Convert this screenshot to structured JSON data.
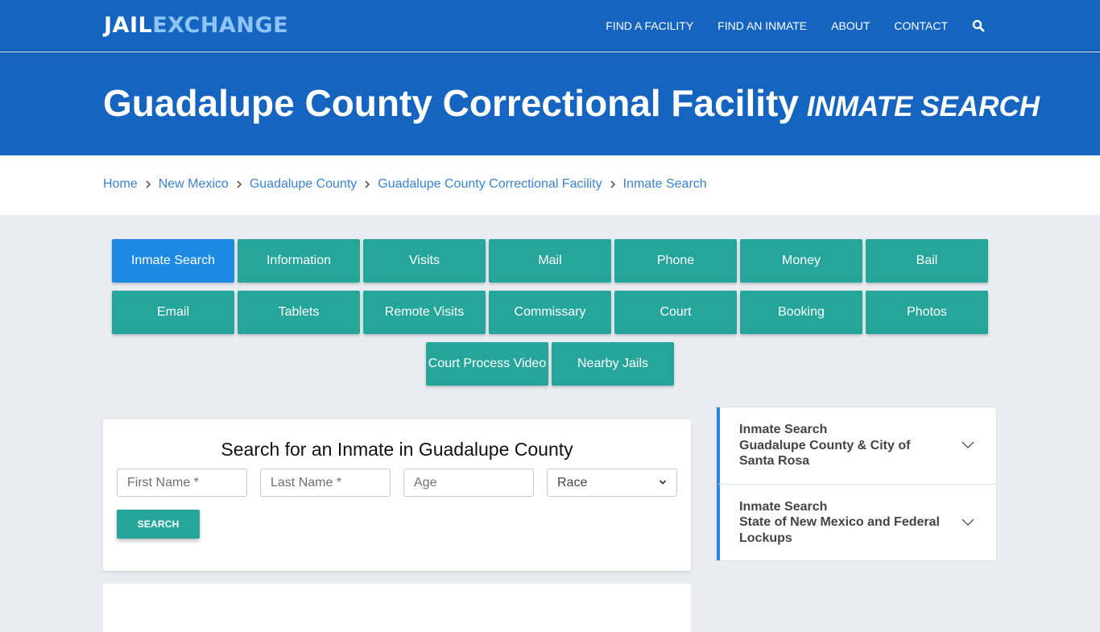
{
  "nav": {
    "logo_part1": "JAIL",
    "logo_part2": "EXCHANGE",
    "links": [
      "FIND A FACILITY",
      "FIND AN INMATE",
      "ABOUT",
      "CONTACT"
    ],
    "search_icon": "search-icon",
    "colors": {
      "bar": "#1565c0",
      "logo_accent": "#8cc4f5"
    }
  },
  "hero": {
    "title": "Guadalupe County Correctional Facility",
    "subtitle": "INMATE SEARCH"
  },
  "breadcrumb": [
    "Home",
    "New Mexico",
    "Guadalupe County",
    "Guadalupe County Correctional Facility",
    "Inmate Search"
  ],
  "tiles": {
    "rows": [
      [
        "Inmate Search",
        "Information",
        "Visits",
        "Mail",
        "Phone",
        "Money",
        "Bail"
      ],
      [
        "Email",
        "Tablets",
        "Remote Visits",
        "Commissary",
        "Court",
        "Booking",
        "Photos"
      ],
      [
        "Court Process Video",
        "Nearby Jails"
      ]
    ],
    "active": "Inmate Search",
    "colors": {
      "default": "#26a69a",
      "active": "#1e88e5"
    }
  },
  "search_form": {
    "heading": "Search for an Inmate in Guadalupe County",
    "first_name_placeholder": "First Name *",
    "last_name_placeholder": "Last Name *",
    "age_placeholder": "Age",
    "race_selected": "Race",
    "submit_label": "SEARCH"
  },
  "sidebar": {
    "items": [
      {
        "line1": "Inmate Search",
        "line2": "Guadalupe County & City of Santa Rosa"
      },
      {
        "line1": "Inmate Search",
        "line2": "State of New Mexico and Federal Lockups"
      }
    ]
  }
}
